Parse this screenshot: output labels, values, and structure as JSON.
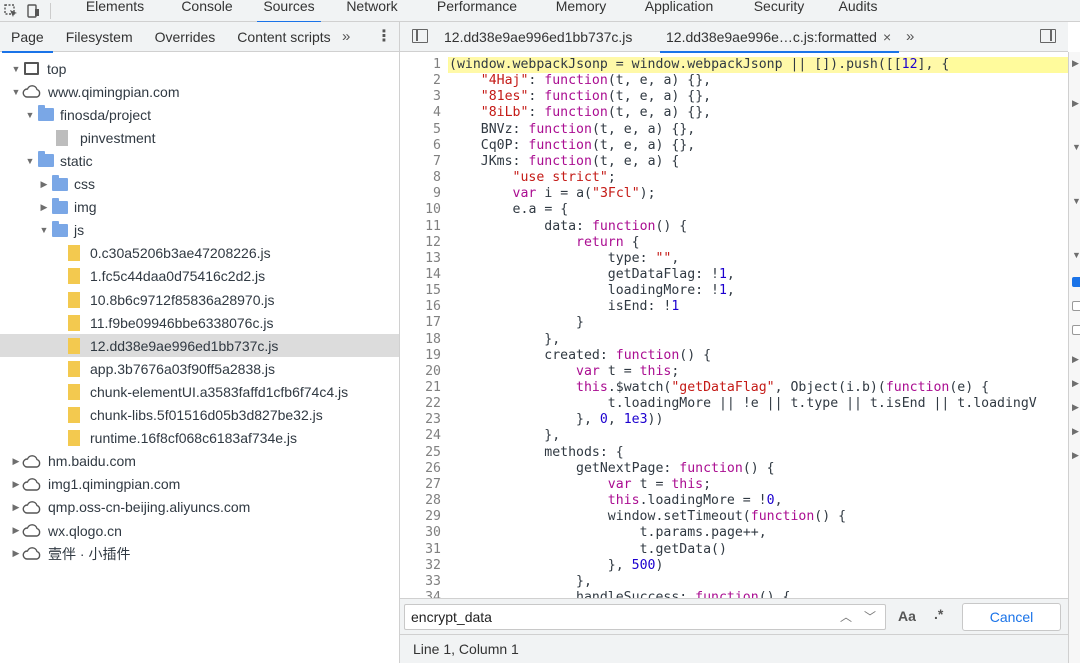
{
  "main_tabs": [
    "Elements",
    "Console",
    "Sources",
    "Network",
    "Performance",
    "Memory",
    "Application",
    "Security",
    "Audits"
  ],
  "navigator": {
    "tabs": [
      "Page",
      "Filesystem",
      "Overrides",
      "Content scripts"
    ],
    "more": "»",
    "menu": "⋮",
    "tree": [
      {
        "label": "top",
        "icon": "frame-icon",
        "arrow": "▼"
      },
      {
        "label": "www.qimingpian.com",
        "icon": "cloud-icon",
        "arrow": "▼"
      },
      {
        "label": "finosda/project",
        "icon": "folder-icon",
        "arrow": "▼"
      },
      {
        "label": "pinvestment",
        "icon": "document-icon",
        "arrow": ""
      },
      {
        "label": "static",
        "icon": "folder-icon",
        "arrow": "▼"
      },
      {
        "label": "css",
        "icon": "folder-icon",
        "arrow": "▶"
      },
      {
        "label": "img",
        "icon": "folder-icon",
        "arrow": "▶"
      },
      {
        "label": "js",
        "icon": "folder-icon",
        "arrow": "▼"
      },
      {
        "label": "0.c30a5206b3ae47208226.js",
        "icon": "file-icon",
        "arrow": ""
      },
      {
        "label": "1.fc5c44daa0d75416c2d2.js",
        "icon": "file-icon",
        "arrow": ""
      },
      {
        "label": "10.8b6c9712f85836a28970.js",
        "icon": "file-icon",
        "arrow": ""
      },
      {
        "label": "11.f9be09946bbe6338076c.js",
        "icon": "file-icon",
        "arrow": ""
      },
      {
        "label": "12.dd38e9ae996ed1bb737c.js",
        "icon": "file-icon",
        "arrow": "",
        "selected": true
      },
      {
        "label": "app.3b7676a03f90ff5a2838.js",
        "icon": "file-icon",
        "arrow": ""
      },
      {
        "label": "chunk-elementUI.a3583faffd1cfb6f74c4.js",
        "icon": "file-icon",
        "arrow": ""
      },
      {
        "label": "chunk-libs.5f01516d05b3d827be32.js",
        "icon": "file-icon",
        "arrow": ""
      },
      {
        "label": "runtime.16f8cf068c6183af734e.js",
        "icon": "file-icon",
        "arrow": ""
      },
      {
        "label": "hm.baidu.com",
        "icon": "cloud-icon",
        "arrow": "▶"
      },
      {
        "label": "img1.qimingpian.com",
        "icon": "cloud-icon",
        "arrow": "▶"
      },
      {
        "label": "qmp.oss-cn-beijing.aliyuncs.com",
        "icon": "cloud-icon",
        "arrow": "▶"
      },
      {
        "label": "wx.qlogo.cn",
        "icon": "cloud-icon",
        "arrow": "▶"
      },
      {
        "label": "壹伴 · 小插件",
        "icon": "cloud-icon",
        "arrow": "▶"
      }
    ]
  },
  "editor": {
    "file_tabs": [
      {
        "label": "12.dd38e9ae996ed1bb737c.js"
      },
      {
        "label": "12.dd38e9ae996e…c.js:formatted",
        "close": "×"
      }
    ],
    "more": "»",
    "code_lines": [
      "(window.webpackJsonp = window.webpackJsonp || []).push([[12], {",
      "    \"4Haj\": function(t, e, a) {},",
      "    \"81es\": function(t, e, a) {},",
      "    \"8iLb\": function(t, e, a) {},",
      "    BNVz: function(t, e, a) {},",
      "    Cq0P: function(t, e, a) {},",
      "    JKms: function(t, e, a) {",
      "        \"use strict\";",
      "        var i = a(\"3Fcl\");",
      "        e.a = {",
      "            data: function() {",
      "                return {",
      "                    type: \"\",",
      "                    getDataFlag: !1,",
      "                    loadingMore: !1,",
      "                    isEnd: !1",
      "                }",
      "            },",
      "            created: function() {",
      "                var t = this;",
      "                this.$watch(\"getDataFlag\", Object(i.b)(function(e) {",
      "                    t.loadingMore || !e || t.type || t.isEnd || t.loadingV",
      "                }, 0, 1e3))",
      "            },",
      "            methods: {",
      "                getNextPage: function() {",
      "                    var t = this;",
      "                    this.loadingMore = !0,",
      "                    window.setTimeout(function() {",
      "                        t.params.page++,",
      "                        t.getData()",
      "                    }, 500)",
      "                },",
      "                handleSuccess: function() {"
    ],
    "search": {
      "value": "encrypt_data",
      "prev": "︿",
      "next": "﹀",
      "match_case": "Aa",
      "regex": ".*",
      "cancel": "Cancel"
    },
    "status": "Line 1, Column 1"
  },
  "colors": {
    "accent": "#1a73e8",
    "highlight": "#fffb9c",
    "keyword": "#aa0d91",
    "string": "#c41a16",
    "number": "#1c00cf"
  }
}
